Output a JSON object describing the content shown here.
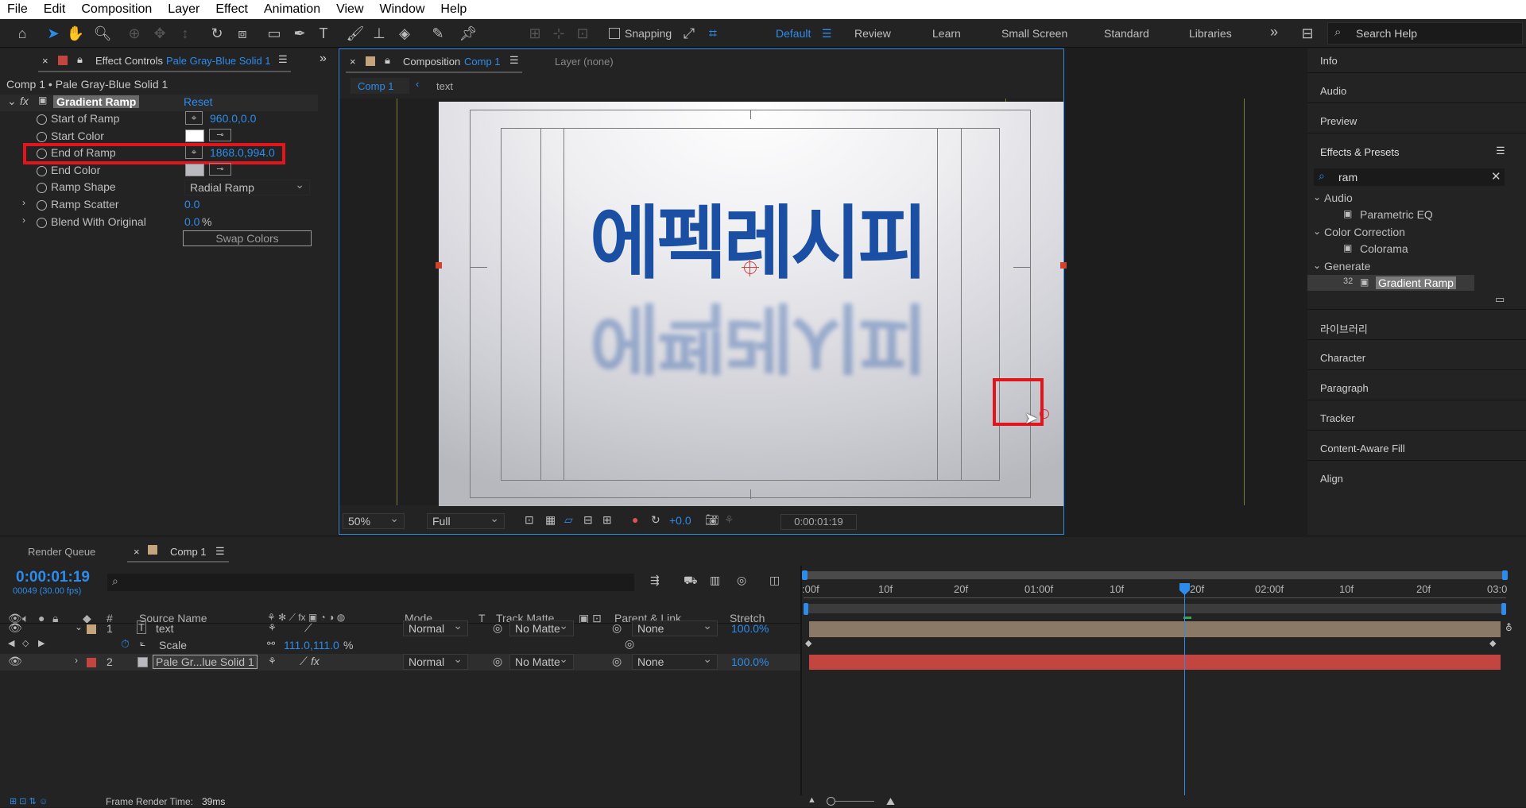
{
  "menu": [
    "File",
    "Edit",
    "Composition",
    "Layer",
    "Effect",
    "Animation",
    "View",
    "Window",
    "Help"
  ],
  "toolbar": {
    "snapping": "Snapping",
    "workspaces": [
      "Default",
      "Review",
      "Learn",
      "Small Screen",
      "Standard",
      "Libraries"
    ],
    "search_help": "Search Help"
  },
  "effect_controls": {
    "tab_prefix": "Effect Controls",
    "tab_layer": "Pale Gray-Blue Solid 1",
    "breadcrumb": "Comp 1 • Pale Gray-Blue Solid 1",
    "effect_name": "Gradient Ramp",
    "reset": "Reset",
    "props": {
      "start_of_ramp": "Start of Ramp",
      "start_of_ramp_value": "960.0,0.0",
      "start_color": "Start Color",
      "end_of_ramp": "End of Ramp",
      "end_of_ramp_value": "1868.0,994.0",
      "end_color": "End Color",
      "ramp_shape": "Ramp Shape",
      "ramp_shape_value": "Radial Ramp",
      "ramp_scatter": "Ramp Scatter",
      "ramp_scatter_value": "0.0",
      "blend": "Blend With Original",
      "blend_value": "0.0",
      "blend_unit": "%",
      "swap_colors": "Swap Colors"
    }
  },
  "composition": {
    "tab_prefix": "Composition",
    "tab_name": "Comp 1",
    "layer_tab": "Layer (none)",
    "nav_comp": "Comp 1",
    "nav_layer": "text",
    "canvas_text": "에펙레시피",
    "zoom": "50%",
    "resolution": "Full",
    "exposure": "+0.0",
    "timecode": "0:00:01:19"
  },
  "right_panel": {
    "items": [
      "Info",
      "Audio",
      "Preview"
    ],
    "effects_title": "Effects & Presets",
    "search_value": "ram",
    "tree": [
      {
        "cat": "Audio",
        "item": "Parametric EQ"
      },
      {
        "cat": "Color Correction",
        "item": "Colorama"
      },
      {
        "cat": "Generate",
        "item": "Gradient Ramp"
      }
    ],
    "more": [
      "라이브러리",
      "Character",
      "Paragraph",
      "Tracker",
      "Content-Aware Fill",
      "Align"
    ]
  },
  "timeline": {
    "render_queue": "Render Queue",
    "comp_tab": "Comp 1",
    "timecode": "0:00:01:19",
    "fps": "00049 (30.00 fps)",
    "cols": {
      "num": "#",
      "source": "Source Name",
      "mode": "Mode",
      "t": "T",
      "track": "Track Matte",
      "parent": "Parent & Link",
      "stretch": "Stretch"
    },
    "layers": [
      {
        "num": "1",
        "name": "text",
        "mode": "Normal",
        "matte": "No Matte",
        "parent": "None",
        "stretch": "100.0%"
      },
      {
        "num": "2",
        "name": "Pale Gr...lue Solid 1",
        "mode": "Normal",
        "matte": "No Matte",
        "parent": "None",
        "stretch": "100.0%"
      }
    ],
    "scale_label": "Scale",
    "scale_value": "111.0,111.0",
    "scale_unit": "%",
    "ruler": [
      ":00f",
      "10f",
      "20f",
      "01:00f",
      "10f",
      "20f",
      "02:00f",
      "10f",
      "20f",
      "03:0"
    ],
    "status_label": "Frame Render Time:",
    "status_value": "39ms"
  },
  "colors": {
    "accent": "#2d8ceb",
    "highlight_red": "#e3151c",
    "title_blue": "#1a4fa3",
    "layer1": "#8a7966",
    "layer2": "#c2453f"
  }
}
